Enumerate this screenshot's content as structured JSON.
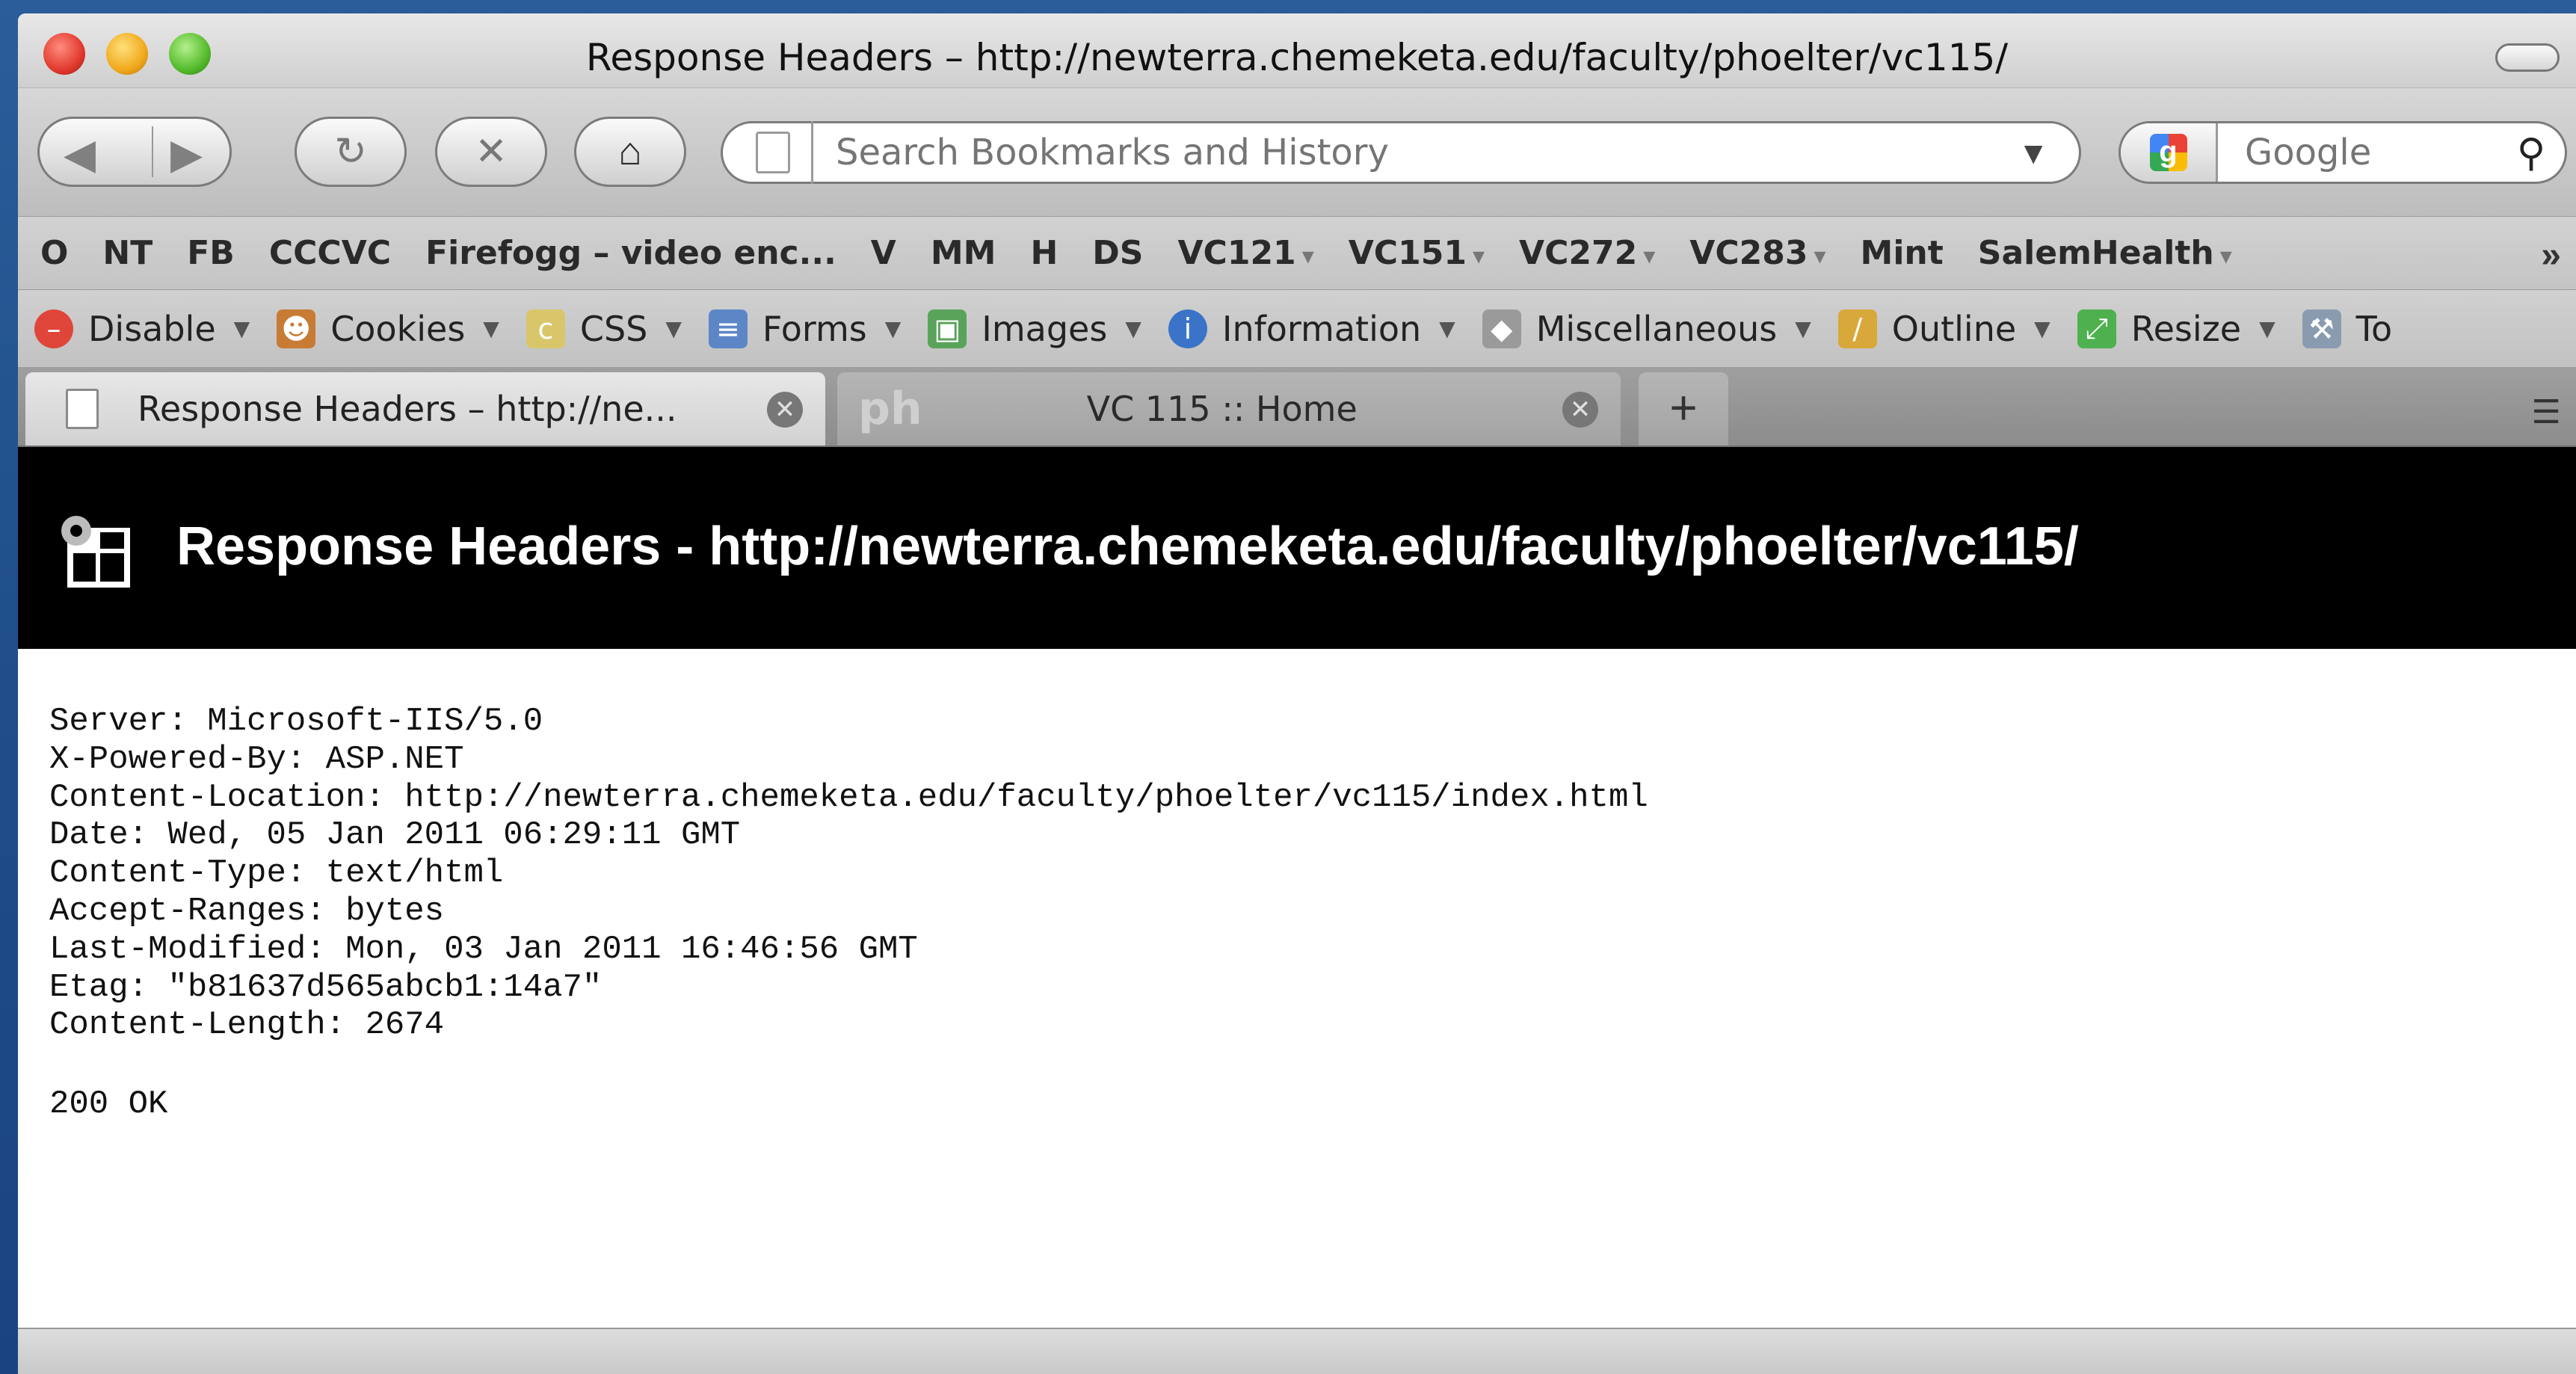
{
  "window": {
    "title": "Response Headers – http://newterra.chemeketa.edu/faculty/phoelter/vc115/"
  },
  "navbar": {
    "back_icon": "back-arrow-icon",
    "forward_icon": "forward-arrow-icon",
    "reload_icon": "reload-icon",
    "stop_icon": "stop-icon",
    "home_icon": "home-icon",
    "url_placeholder": "Search Bookmarks and History",
    "search_placeholder": "Google"
  },
  "bookmarks": {
    "items": [
      "O",
      "NT",
      "FB",
      "CCCVC",
      "Firefogg – video enc...",
      "V",
      "MM",
      "H",
      "DS",
      "VC121",
      "VC151",
      "VC272",
      "VC283",
      "Mint",
      "SalemHealth"
    ],
    "more": "»"
  },
  "devbar": {
    "items": [
      {
        "label": "Disable",
        "icon": "disable-icon",
        "color": "#e0453a"
      },
      {
        "label": "Cookies",
        "icon": "cookies-icon",
        "color": "#c77b34"
      },
      {
        "label": "CSS",
        "icon": "css-icon",
        "color": "#d9c66a"
      },
      {
        "label": "Forms",
        "icon": "forms-icon",
        "color": "#5d86c7"
      },
      {
        "label": "Images",
        "icon": "images-icon",
        "color": "#5aa35a"
      },
      {
        "label": "Information",
        "icon": "information-icon",
        "color": "#3a73c8"
      },
      {
        "label": "Miscellaneous",
        "icon": "miscellaneous-icon",
        "color": "#9a9a9a"
      },
      {
        "label": "Outline",
        "icon": "outline-icon",
        "color": "#d9a83a"
      },
      {
        "label": "Resize",
        "icon": "resize-icon",
        "color": "#4fb04f"
      },
      {
        "label": "To",
        "icon": "tools-icon",
        "color": "#8a9bb0"
      }
    ]
  },
  "tabs": [
    {
      "label": "Response Headers – http://ne..."
    },
    {
      "label": "VC 115 :: Home",
      "favicon_text": "ph"
    }
  ],
  "newtab_label": "+",
  "page": {
    "title": "Response Headers - http://newterra.chemeketa.edu/faculty/phoelter/vc115/",
    "headers": [
      "Server: Microsoft-IIS/5.0",
      "X-Powered-By: ASP.NET",
      "Content-Location: http://newterra.chemeketa.edu/faculty/phoelter/vc115/index.html",
      "Date: Wed, 05 Jan 2011 06:29:11 GMT",
      "Content-Type: text/html",
      "Accept-Ranges: bytes",
      "Last-Modified: Mon, 03 Jan 2011 16:46:56 GMT",
      "Etag: \"b81637d565abcb1:14a7\"",
      "Content-Length: 2674"
    ],
    "status": "200 OK"
  }
}
